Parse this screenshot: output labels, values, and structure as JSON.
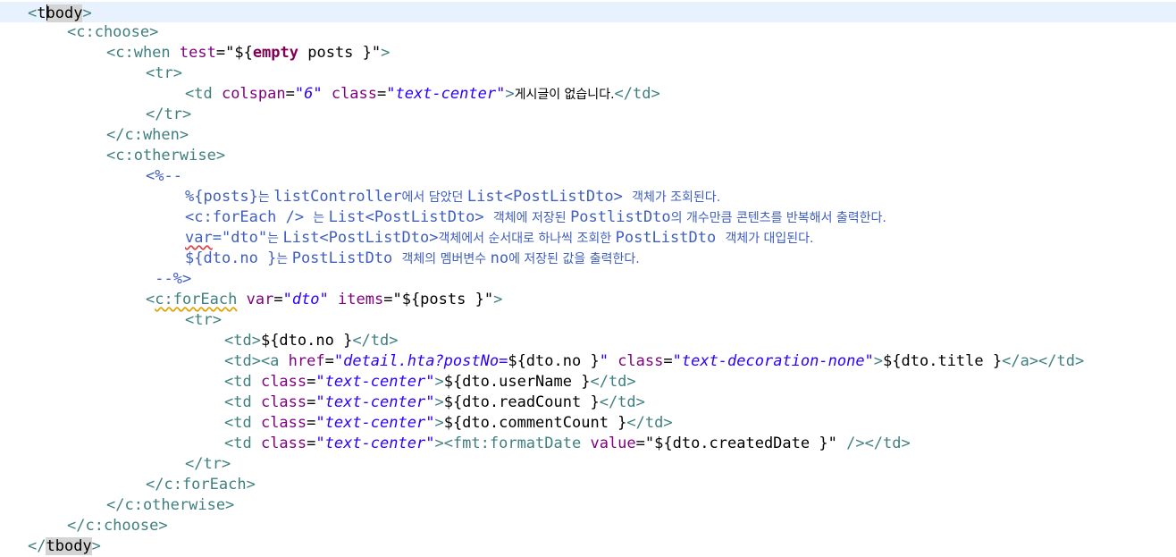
{
  "editor": {
    "cursor_line": 0,
    "lines": [
      {
        "indent": 0,
        "tokens": [
          [
            "tag",
            "<"
          ],
          [
            "txt",
            "t"
          ],
          [
            "cur",
            ""
          ],
          [
            "txt",
            "body",
            "hl"
          ],
          [
            "tag",
            ">"
          ]
        ]
      },
      {
        "indent": 1,
        "tokens": [
          [
            "tag",
            "<c:choose>"
          ]
        ]
      },
      {
        "indent": 2,
        "tokens": [
          [
            "tag",
            "<c:when "
          ],
          [
            "attr",
            "test"
          ],
          [
            "txt",
            "=\""
          ],
          [
            "el",
            "${"
          ],
          [
            "kw",
            "empty"
          ],
          [
            "el",
            " posts }"
          ],
          [
            "txt",
            "\""
          ],
          [
            "tag",
            ">"
          ]
        ]
      },
      {
        "indent": 3,
        "tokens": [
          [
            "tag",
            "<tr>"
          ]
        ]
      },
      {
        "indent": 4,
        "tokens": [
          [
            "tag",
            "<td "
          ],
          [
            "attr",
            "colspan"
          ],
          [
            "txt",
            "="
          ],
          [
            "str",
            "\"6\""
          ],
          [
            "txt",
            " "
          ],
          [
            "attr",
            "class"
          ],
          [
            "txt",
            "="
          ],
          [
            "str",
            "\"text-center\""
          ],
          [
            "tag",
            ">"
          ],
          [
            "ko",
            "게시글이 없습니다."
          ],
          [
            "tag",
            "</td>"
          ]
        ]
      },
      {
        "indent": 3,
        "tokens": [
          [
            "tag",
            "</tr>"
          ]
        ]
      },
      {
        "indent": 2,
        "tokens": [
          [
            "tag",
            "</c:when>"
          ]
        ]
      },
      {
        "indent": 2,
        "tokens": [
          [
            "tag",
            "<c:otherwise>"
          ]
        ]
      },
      {
        "indent": 3,
        "tokens": [
          [
            "cmt",
            "<%--"
          ]
        ]
      },
      {
        "indent": 4,
        "tokens": [
          [
            "cmt",
            "%{posts}"
          ],
          [
            "cmtko",
            "는 "
          ],
          [
            "cmt",
            "listController"
          ],
          [
            "cmtko",
            "에서 담았던 "
          ],
          [
            "cmt",
            "List<PostListDto> "
          ],
          [
            "cmtko",
            "객체가 조회된다."
          ]
        ]
      },
      {
        "indent": 4,
        "tokens": [
          [
            "cmt",
            "<c:forEach /> "
          ],
          [
            "cmtko",
            "는 "
          ],
          [
            "cmt",
            "List<PostListDto> "
          ],
          [
            "cmtko",
            "객체에 저장된 "
          ],
          [
            "cmt",
            "PostlistDto"
          ],
          [
            "cmtko",
            "의 개수만큼 콘텐츠를 반복해서 출력한다."
          ]
        ]
      },
      {
        "indent": 4,
        "tokens": [
          [
            "cmt",
            "var",
            "err"
          ],
          [
            "cmt",
            "=\"dto\""
          ],
          [
            "cmtko",
            "는 "
          ],
          [
            "cmt",
            "List<PostListDto>"
          ],
          [
            "cmtko",
            "객체에서 순서대로 하나씩 조회한 "
          ],
          [
            "cmt",
            "PostListDto "
          ],
          [
            "cmtko",
            "객체가 대입된다."
          ]
        ]
      },
      {
        "indent": 4,
        "tokens": [
          [
            "cmt",
            "${dto.no }"
          ],
          [
            "cmtko",
            "는 "
          ],
          [
            "cmt",
            "PostListDto "
          ],
          [
            "cmtko",
            "객체의 멤버변수 "
          ],
          [
            "cmt",
            "no"
          ],
          [
            "cmtko",
            "에 저장된 값을 출력한다."
          ]
        ]
      },
      {
        "indent": 3,
        "tokens": [
          [
            "cmt",
            " --%>"
          ]
        ]
      },
      {
        "indent": 3,
        "tokens": [
          [
            "tag",
            "<"
          ],
          [
            "tag",
            "c:forEach",
            "warn"
          ],
          [
            "txt",
            " "
          ],
          [
            "attr",
            "var"
          ],
          [
            "txt",
            "="
          ],
          [
            "str",
            "\"dto\""
          ],
          [
            "txt",
            " "
          ],
          [
            "attr",
            "items"
          ],
          [
            "txt",
            "=\""
          ],
          [
            "el",
            "${posts }"
          ],
          [
            "txt",
            "\""
          ],
          [
            "tag",
            ">"
          ]
        ]
      },
      {
        "indent": 4,
        "tokens": [
          [
            "tag",
            "<tr>"
          ]
        ]
      },
      {
        "indent": 5,
        "tokens": [
          [
            "tag",
            "<td>"
          ],
          [
            "el",
            "${dto.no }"
          ],
          [
            "tag",
            "</td>"
          ]
        ]
      },
      {
        "indent": 5,
        "tokens": [
          [
            "tag",
            "<td><a "
          ],
          [
            "attr",
            "href"
          ],
          [
            "txt",
            "="
          ],
          [
            "str",
            "\"detail.hta?postNo="
          ],
          [
            "el",
            "${dto.no }"
          ],
          [
            "str",
            "\""
          ],
          [
            "txt",
            " "
          ],
          [
            "attr",
            "class"
          ],
          [
            "txt",
            "="
          ],
          [
            "str",
            "\"text-decoration-none\""
          ],
          [
            "tag",
            ">"
          ],
          [
            "el",
            "${dto.title }"
          ],
          [
            "tag",
            "</a></td>"
          ]
        ]
      },
      {
        "indent": 5,
        "tokens": [
          [
            "tag",
            "<td "
          ],
          [
            "attr",
            "class"
          ],
          [
            "txt",
            "="
          ],
          [
            "str",
            "\"text-center\""
          ],
          [
            "tag",
            ">"
          ],
          [
            "el",
            "${dto.userName }"
          ],
          [
            "tag",
            "</td>"
          ]
        ]
      },
      {
        "indent": 5,
        "tokens": [
          [
            "tag",
            "<td "
          ],
          [
            "attr",
            "class"
          ],
          [
            "txt",
            "="
          ],
          [
            "str",
            "\"text-center\""
          ],
          [
            "tag",
            ">"
          ],
          [
            "el",
            "${dto.readCount }"
          ],
          [
            "tag",
            "</td>"
          ]
        ]
      },
      {
        "indent": 5,
        "tokens": [
          [
            "tag",
            "<td "
          ],
          [
            "attr",
            "class"
          ],
          [
            "txt",
            "="
          ],
          [
            "str",
            "\"text-center\""
          ],
          [
            "tag",
            ">"
          ],
          [
            "el",
            "${dto.commentCount }"
          ],
          [
            "tag",
            "</td>"
          ]
        ]
      },
      {
        "indent": 5,
        "tokens": [
          [
            "tag",
            "<td "
          ],
          [
            "attr",
            "class"
          ],
          [
            "txt",
            "="
          ],
          [
            "str",
            "\"text-center\""
          ],
          [
            "tag",
            "><fmt:formatDate "
          ],
          [
            "attr",
            "value"
          ],
          [
            "txt",
            "=\""
          ],
          [
            "el",
            "${dto.createdDate }"
          ],
          [
            "txt",
            "\""
          ],
          [
            "tag",
            " />"
          ],
          [
            "tag",
            "</td>"
          ]
        ]
      },
      {
        "indent": 4,
        "tokens": [
          [
            "tag",
            "</tr>"
          ]
        ]
      },
      {
        "indent": 3,
        "tokens": [
          [
            "tag",
            "</c:forEach>"
          ]
        ]
      },
      {
        "indent": 2,
        "tokens": [
          [
            "tag",
            "</c:otherwise>"
          ]
        ]
      },
      {
        "indent": 1,
        "tokens": [
          [
            "tag",
            "</c:choose>"
          ]
        ]
      },
      {
        "indent": 0,
        "tokens": [
          [
            "tag",
            "</"
          ],
          [
            "txt",
            "tbody",
            "hl"
          ],
          [
            "tag",
            ">"
          ]
        ]
      }
    ]
  }
}
